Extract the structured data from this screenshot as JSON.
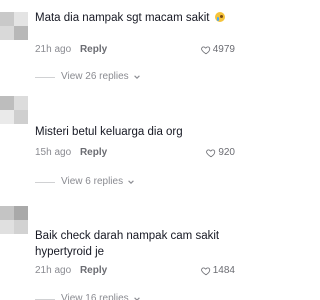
{
  "comments": [
    {
      "text": "Mata dia nampak sgt macam sakit",
      "emoji_icon": "crying-face-emoji-icon",
      "time": "21h ago",
      "reply_label": "Reply",
      "likes": "4979",
      "view_replies": "View 26 replies"
    },
    {
      "text": "Misteri betul keluarga dia org",
      "time": "15h ago",
      "reply_label": "Reply",
      "likes": "920",
      "view_replies": "View 6 replies"
    },
    {
      "text": "Baik check darah nampak cam sakit hypertyroid je",
      "time": "21h ago",
      "reply_label": "Reply",
      "likes": "1484",
      "view_replies": "View 16 replies"
    }
  ],
  "colors": {
    "text": "#161823",
    "muted": "#8a8b91",
    "secondary": "#6b6c72",
    "divider": "#d0d1d3"
  }
}
